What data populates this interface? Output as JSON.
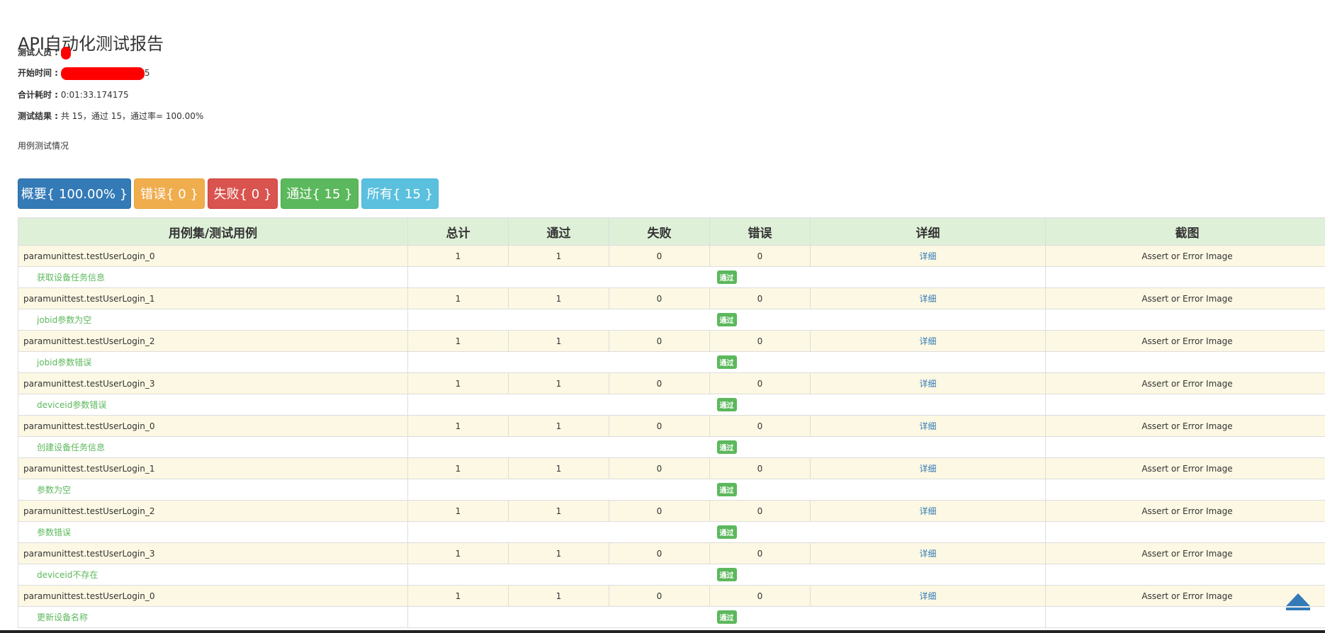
{
  "report": {
    "title": "API自动化测试报告",
    "tester_label": "测试人员 :",
    "start_label": "开始时间 :",
    "start_tail": "5",
    "duration_label": "合计耗时 :",
    "duration_value": "0:01:33.174175",
    "result_label": "测试结果 :",
    "result_value": "共 15，通过 15，通过率= 100.00%",
    "section_heading": "用例测试情况"
  },
  "filters": {
    "summary": "概要{ 100.00% }",
    "error": "错误{ 0 }",
    "failed": "失败{ 0 }",
    "passed": "通过{ 15 }",
    "all": "所有{ 15 }"
  },
  "table": {
    "headers": [
      "用例集/测试用例",
      "总计",
      "通过",
      "失败",
      "错误",
      "详细",
      "截图"
    ],
    "detail_link": "详细",
    "screenshot_text": "Assert or Error Image",
    "pass_badge": "通过",
    "rows": [
      {
        "suite": "paramunittest.testUserLogin_0",
        "total": "1",
        "pass": "1",
        "fail": "0",
        "error": "0",
        "case": "获取设备任务信息"
      },
      {
        "suite": "paramunittest.testUserLogin_1",
        "total": "1",
        "pass": "1",
        "fail": "0",
        "error": "0",
        "case": "jobid参数为空"
      },
      {
        "suite": "paramunittest.testUserLogin_2",
        "total": "1",
        "pass": "1",
        "fail": "0",
        "error": "0",
        "case": "jobid参数错误"
      },
      {
        "suite": "paramunittest.testUserLogin_3",
        "total": "1",
        "pass": "1",
        "fail": "0",
        "error": "0",
        "case": "deviceid参数错误"
      },
      {
        "suite": "paramunittest.testUserLogin_0",
        "total": "1",
        "pass": "1",
        "fail": "0",
        "error": "0",
        "case": "创建设备任务信息"
      },
      {
        "suite": "paramunittest.testUserLogin_1",
        "total": "1",
        "pass": "1",
        "fail": "0",
        "error": "0",
        "case": "参数为空"
      },
      {
        "suite": "paramunittest.testUserLogin_2",
        "total": "1",
        "pass": "1",
        "fail": "0",
        "error": "0",
        "case": "参数错误"
      },
      {
        "suite": "paramunittest.testUserLogin_3",
        "total": "1",
        "pass": "1",
        "fail": "0",
        "error": "0",
        "case": "deviceid不存在"
      },
      {
        "suite": "paramunittest.testUserLogin_0",
        "total": "1",
        "pass": "1",
        "fail": "0",
        "error": "0",
        "case": "更新设备名称"
      }
    ]
  },
  "colors": {
    "header_bg": "#dff0d8",
    "suite_row_bg": "#fcf8e3",
    "pass_green": "#5cb85c",
    "link_blue": "#337ab7",
    "redaction": "#ff0000"
  },
  "icons": {
    "back_to_top": "triangle-up-icon"
  }
}
